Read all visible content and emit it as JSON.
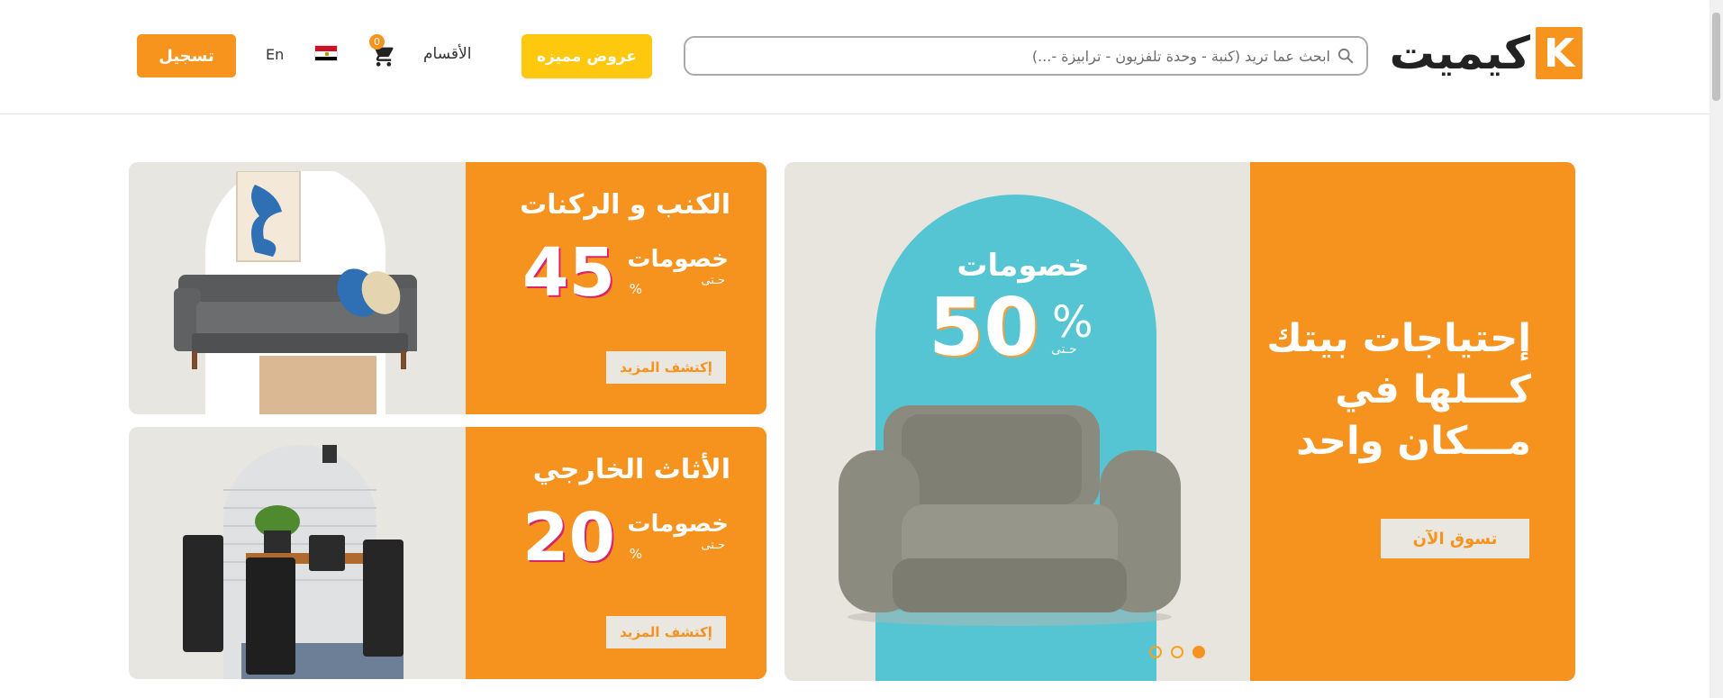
{
  "header": {
    "logo_mark": "K",
    "logo_text": "كيميت",
    "search": {
      "placeholder": "ابحث عما تريد (كنبة - وحدة تلفزيون - ترابيزة -...)",
      "icon": "search-icon"
    },
    "offers_label": "عروض مميزه",
    "categories_label": "الأقسام",
    "cart": {
      "icon": "cart-icon",
      "count": "0"
    },
    "flag": "egypt-flag-icon",
    "language_label": "En",
    "register_label": "تسجيل"
  },
  "hero": {
    "title_line1": "إحتياجات بيتك",
    "title_line2": "كـــلها في",
    "title_line3": "مـــكان واحد",
    "discount_word": "خصومات",
    "discount_value": "50",
    "discount_symbol": "%",
    "up_to": "حـتى",
    "cta_label": "تسوق الآن",
    "slides": {
      "count": 3,
      "active_index": 0
    }
  },
  "cards": [
    {
      "title": "الكنب و الركنات",
      "discount_word": "خصومات",
      "up_to": "حـتى",
      "discount_value": "45",
      "discount_symbol": "%",
      "cta_label": "إكتشف المزيد",
      "image": "sofa-image"
    },
    {
      "title": "الأثاث الخارجي",
      "discount_word": "خصومات",
      "up_to": "حـتى",
      "discount_value": "20",
      "discount_symbol": "%",
      "cta_label": "إكتشف المزيد",
      "image": "outdoor-dining-set-image"
    }
  ],
  "colors": {
    "brand_orange": "#f6921e",
    "offers_yellow": "#fdc80d",
    "hero_teal": "#55c5d3",
    "panel_beige": "#e8e6e1"
  }
}
